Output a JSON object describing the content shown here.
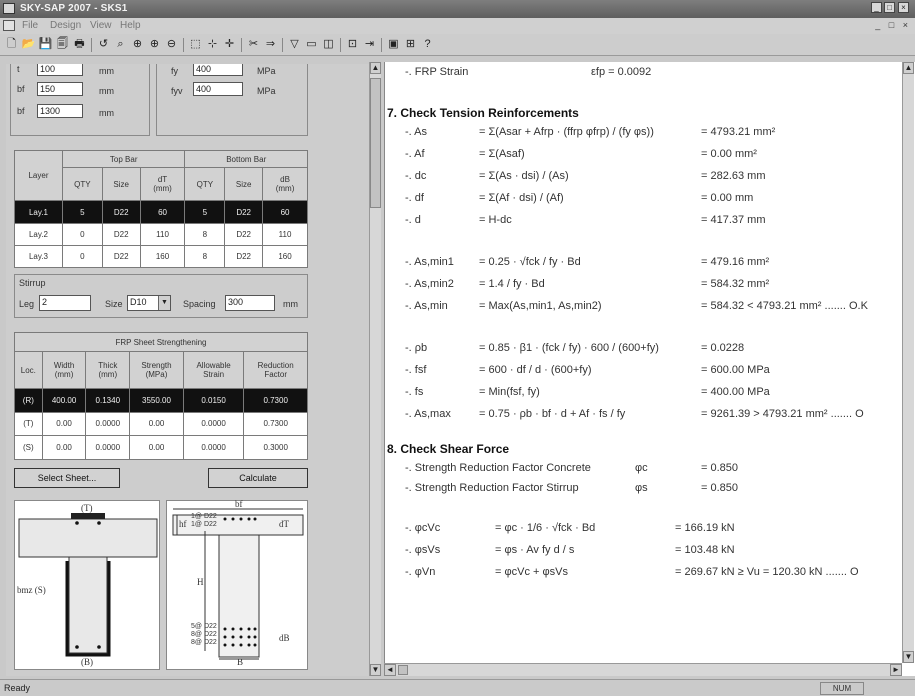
{
  "window": {
    "title": "SKY-SAP 2007 - SKS1",
    "min_label": "_",
    "max_label": "□",
    "close_label": "×"
  },
  "menu": [
    "File",
    "Design",
    "View",
    "Help"
  ],
  "mdi_buttons": "_ □ ×",
  "toolbar_icons": [
    "new-file-icon",
    "open-folder-icon",
    "save-icon",
    "print-preview-icon",
    "print-icon",
    "pan-icon",
    "zoom-window-icon",
    "zoom-fit-icon",
    "zoom-in-icon",
    "zoom-out-icon",
    "select-icon",
    "measure-icon",
    "move-icon",
    "cut-icon",
    "paste-icon",
    "filter-icon",
    "rectangle-icon",
    "section-icon",
    "report-icon",
    "export-icon",
    "calc-icon",
    "layout-icon",
    "help-icon"
  ],
  "toolbar_glyphs": [
    "🗋",
    "📂",
    "💾",
    "🗐",
    "🖶",
    "↺",
    "⌕",
    "⊕",
    "⊕",
    "⊖",
    "⬚",
    "⊹",
    "✛",
    "✂",
    "⇒",
    "▽",
    "▭",
    "◫",
    "⊡",
    "⇥",
    "▣",
    "⊞",
    "?"
  ],
  "section": {
    "t_label": "t",
    "t_value": "100",
    "t_unit": "mm",
    "bw_label": "bf",
    "bw_value": "150",
    "bw_unit": "mm",
    "h_label": "bf",
    "h_value": "1300",
    "h_unit": "mm",
    "fy_label": "fy",
    "fy_value": "400",
    "fy_unit": "MPa",
    "fyv_label": "fyv",
    "fyv_value": "400",
    "fyv_unit": "MPa"
  },
  "bar_table": {
    "top_header": "Top Bar",
    "bottom_header": "Bottom Bar",
    "col_layer": "Layer",
    "col_qty": "QTY",
    "col_size": "Size",
    "col_dt": "dT",
    "col_dt_unit": "(mm)",
    "col_db": "dB",
    "col_db_unit": "(mm)",
    "rows": [
      {
        "layer": "Lay.1",
        "tqty": "5",
        "tsize": "D22",
        "dt": "60",
        "bqty": "5",
        "bsize": "D22",
        "db": "60"
      },
      {
        "layer": "Lay.2",
        "tqty": "0",
        "tsize": "D22",
        "dt": "110",
        "bqty": "8",
        "bsize": "D22",
        "db": "110"
      },
      {
        "layer": "Lay.3",
        "tqty": "0",
        "tsize": "D22",
        "dt": "160",
        "bqty": "8",
        "bsize": "D22",
        "db": "160"
      }
    ]
  },
  "stirrup": {
    "title": "Stirrup",
    "leg_label": "Leg",
    "leg_value": "2",
    "size_label": "Size",
    "size_value": "D10",
    "spacing_label": "Spacing",
    "spacing_value": "300",
    "spacing_unit": "mm"
  },
  "frp_table": {
    "title": "FRP Sheet Strengthening",
    "col_loc": "Loc.",
    "col_width": "Width",
    "col_width_unit": "(mm)",
    "col_thick": "Thick",
    "col_thick_unit": "(mm)",
    "col_strength": "Strength",
    "col_strength_unit": "(MPa)",
    "col_allow": "Allowable",
    "col_allow_unit": "Strain",
    "col_red": "Reduction",
    "col_red_unit": "Factor",
    "rows": [
      {
        "loc": "(R)",
        "width": "400.00",
        "thick": "0.1340",
        "strength": "3550.00",
        "strain": "0.0150",
        "factor": "0.7300"
      },
      {
        "loc": "(T)",
        "width": "0.00",
        "thick": "0.0000",
        "strength": "0.00",
        "strain": "0.0000",
        "factor": "0.7300"
      },
      {
        "loc": "(S)",
        "width": "0.00",
        "thick": "0.0000",
        "strength": "0.00",
        "strain": "0.0000",
        "factor": "0.3000"
      }
    ]
  },
  "buttons": {
    "select_sheet": "Select Sheet...",
    "calculate": "Calculate"
  },
  "diagram_left": {
    "top_label": "(T)",
    "side_label": "bmz (S)",
    "bottom_label": "(B)"
  },
  "diagram_right": {
    "bf_label": "bf",
    "hf_label": "hf",
    "top_bars": "1@ D22\n1@ D22",
    "dt_label": "dT",
    "h_label": "H",
    "bottom_bars": "5@ D22\n8@ D22\n8@ D22",
    "db_label": "dB",
    "b_label": "B"
  },
  "report": {
    "lines": [
      {
        "id": "frp-strain",
        "t": "-. FRP Strain",
        "m": "εfp  = 0.0092",
        "r": ""
      },
      {
        "id": "sec7",
        "section": "7. Check Tension Reinforcements"
      },
      {
        "id": "as",
        "t": "-. As",
        "m": "= Σ(Asar + Afrp · (ffrp φfrp) / (fy φs))",
        "r": "= 4793.21 mm²"
      },
      {
        "id": "af",
        "t": "-. Af",
        "m": "= Σ(Asaf)",
        "r": "= 0.00 mm²"
      },
      {
        "id": "dc",
        "t": "-. dc",
        "m": "= Σ(As · dsi) / (As)",
        "r": "= 282.63 mm"
      },
      {
        "id": "dr",
        "t": "-. df",
        "m": "= Σ(Af · dsi) / (Af)",
        "r": "= 0.00 mm"
      },
      {
        "id": "d",
        "t": "-. d",
        "m": "= H-dc",
        "r": "= 417.37 mm"
      },
      {
        "id": "asmin1",
        "t": "-. As,min1",
        "m": "= 0.25 · √fck / fy · Bd",
        "r": "= 479.16 mm²"
      },
      {
        "id": "asmin2",
        "t": "-. As,min2",
        "m": "= 1.4 / fy · Bd",
        "r": "= 584.32 mm²"
      },
      {
        "id": "asmin",
        "t": "-. As,min",
        "m": "= Max(As,min1, As,min2)",
        "r": "= 584.32 < 4793.21 mm² ....... O.K"
      },
      {
        "id": "pb",
        "t": "-. ρb",
        "m": "= 0.85 · β1 · (fck / fy) · 600 / (600+fy)",
        "r": "= 0.0228"
      },
      {
        "id": "fsf",
        "t": "-. fsf",
        "m": "= 600 · df / d · (600+fy)",
        "r": "= 600.00 MPa"
      },
      {
        "id": "fs",
        "t": "-. fs",
        "m": "= Min(fsf, fy)",
        "r": "= 400.00 MPa"
      },
      {
        "id": "asmax",
        "t": "-. As,max",
        "m": "= 0.75 · ρb · bf · d + Af · fs / fy",
        "r": "= 9261.39 > 4793.21 mm² ....... O"
      },
      {
        "id": "sec8",
        "section": "8. Check Shear Force"
      },
      {
        "id": "srf-con",
        "t": "-. Strength Reduction Factor  Concrete",
        "m": "φc",
        "r": "= 0.850"
      },
      {
        "id": "srf-sti",
        "t": "-. Strength Reduction Factor  Stirrup",
        "m": "φs",
        "r": "= 0.850"
      },
      {
        "id": "vc",
        "t": "-. φcVc",
        "m": "= φc · 1/6 · √fck · Bd",
        "r": "= 166.19 kN"
      },
      {
        "id": "vs",
        "t": "-. φsVs",
        "m": "= φs · Av fy d / s",
        "r": "= 103.48 kN"
      },
      {
        "id": "vn",
        "t": "-. φVn",
        "m": "= φcVc + φsVs",
        "r": "= 269.67 kN  ≥  Vu = 120.30 kN ....... O"
      }
    ]
  },
  "status": {
    "text": "Ready",
    "num": "NUM"
  }
}
